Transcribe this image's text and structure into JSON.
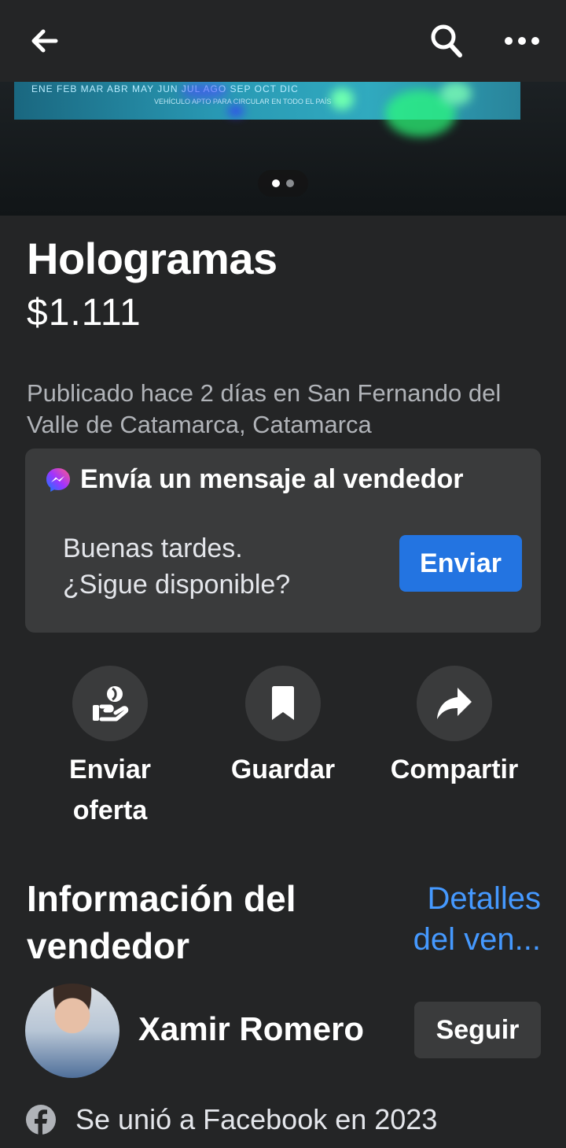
{
  "header": {
    "back_icon": "arrow-left-icon",
    "search_icon": "search-icon",
    "more_icon": "more-horizontal-icon"
  },
  "photo": {
    "months_text": "ENE  FEB  MAR  ABR  MAY  JUN  JUL  AGO  SEP  OCT     DIC",
    "sub_text": "VEHÍCULO APTO PARA CIRCULAR EN TODO EL PAÍS",
    "page_count": 2,
    "current_page": 1
  },
  "listing": {
    "title": "Hologramas",
    "price": "$1.111",
    "posted": "Publicado hace 2 días en San Fernando del Valle de Catamarca, Catamarca"
  },
  "message_card": {
    "heading": "Envía un mensaje al vendedor",
    "message_line1": "Buenas tardes.",
    "message_line2": "¿Sigue disponible?",
    "send_label": "Enviar"
  },
  "actions": [
    {
      "label_line1": "Enviar",
      "label_line2": "oferta",
      "icon": "offer-hand-icon"
    },
    {
      "label_line1": "Guardar",
      "label_line2": "",
      "icon": "bookmark-icon"
    },
    {
      "label_line1": "Compartir",
      "label_line2": "",
      "icon": "share-arrow-icon"
    }
  ],
  "seller": {
    "section_title_line1": "Información del",
    "section_title_line2": "vendedor",
    "details_line1": "Detalles",
    "details_line2": "del ven...",
    "name": "Xamir Romero",
    "follow_label": "Seguir",
    "joined": "Se unió a Facebook en 2023"
  },
  "colors": {
    "background": "#242526",
    "card": "#3a3b3c",
    "accent": "#2374e1",
    "link": "#4599ff"
  }
}
